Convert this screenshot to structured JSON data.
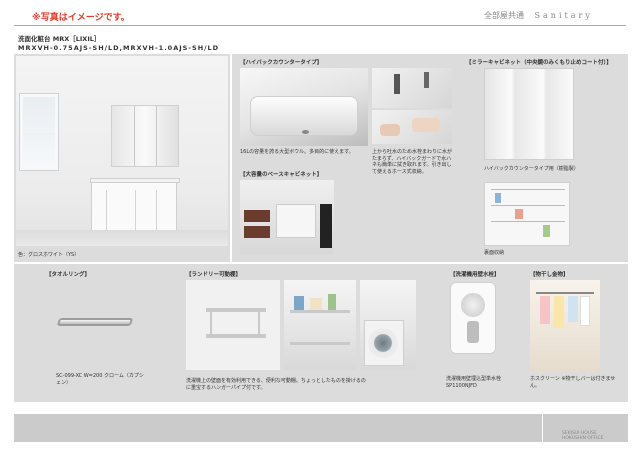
{
  "header": {
    "note": "※写真はイメージです。",
    "right_jp": "全部屋共通",
    "right_en": "Sanitary"
  },
  "product": {
    "title": "洗面化粧台 MRX［LIXIL］",
    "model": "MRXVH-0.75AJS-SH/LD,MRXVH-1.0AJS-SH/LD"
  },
  "main_photo": {
    "caption": "色：グロスホワイト（YS）"
  },
  "sections": {
    "hi_back": {
      "label": "【ハイバックカウンタータイプ】",
      "caption1": "16Lの容量を誇る大型ボウル。多目的に使えます。",
      "caption2": "上から吐水のため水栓まわりに水がたまらず、ハイバックガードで水ハネも簡単に拭き取れます。引き出して使えるホース式収納。"
    },
    "base_cabinet": {
      "label": "【大容量のベースキャビネット】"
    },
    "mirror_cabinet": {
      "label": "【ミラーキャビネット（中央鏡のみくもり止めコート付）】",
      "caption1": "ハイバックカウンタータイプ用（樹脂製）",
      "caption2": "裏面収納"
    },
    "towel_ring": {
      "label": "【タオルリング】",
      "caption": "SC-099-XC W=200 クローム（カプシェン）"
    },
    "laundry": {
      "label": "【ランドリー可動棚】",
      "caption": "洗濯機上の壁面を有効利用できる、便利な可動棚。ちょっとしたものを掛けるのに重宝するハンガーパイプ付です。"
    },
    "washer_faucet": {
      "label": "【洗濯機用壁水栓】",
      "caption": "洗濯機用壁埋込型単水栓 SP1100NJFD"
    },
    "hoshi": {
      "label": "【物干し金物】",
      "caption": "ホスクリーン ※物干しバーは付きません。"
    }
  },
  "footer": {
    "line1": "SEKISUI HOUSE",
    "line2": "HOKUSHIN OFFICE"
  }
}
